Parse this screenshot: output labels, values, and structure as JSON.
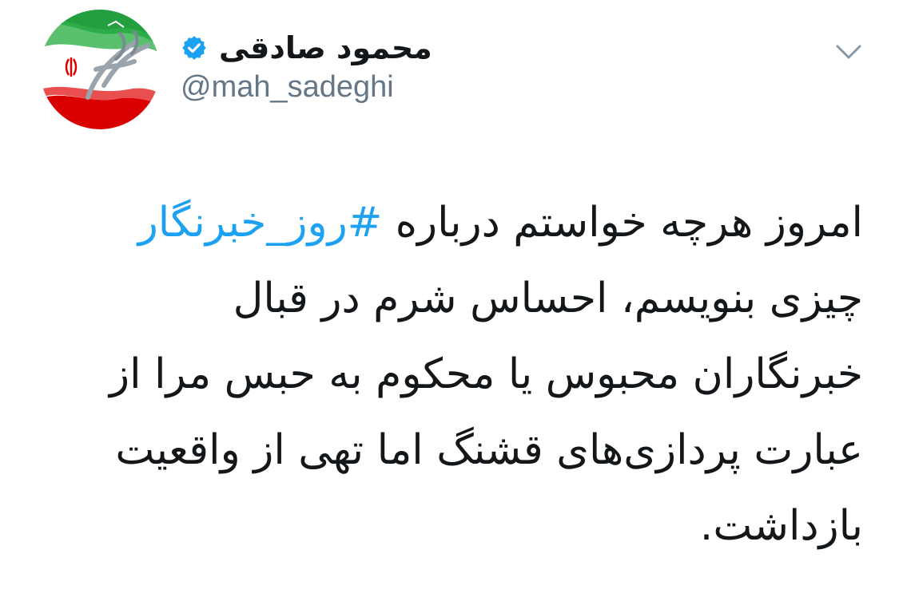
{
  "author": {
    "display_name": "محمود صادقی",
    "handle": "@mah_sadeghi",
    "verified": true,
    "avatar_icon": "iran-flag-calligraphy-logo"
  },
  "menu": {
    "icon": "chevron-down-icon"
  },
  "tweet": {
    "line1_text": "امروز هرچه خواستم درباره ",
    "hashtag": "#روز_خبرنگار",
    "line2": "چیزی بنویسم، احساس شرم در قبال",
    "line3": "خبرنگاران محبوس یا محکوم به حبس مرا از",
    "line4": "عبارت پردازی‌های قشنگ اما تهی از واقعیت",
    "line5": "بازداشت."
  },
  "colors": {
    "text": "#14171a",
    "secondary": "#657786",
    "link": "#1da1f2",
    "verified_badge": "#1da1f2",
    "flag_green": "#239f40",
    "flag_red": "#da0000"
  }
}
